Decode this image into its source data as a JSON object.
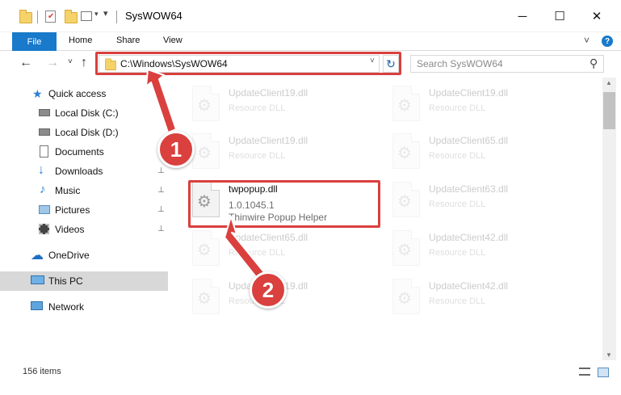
{
  "window": {
    "title": "SysWOW64",
    "minimize": "─",
    "maximize": "☐",
    "close": "✕"
  },
  "ribbon": {
    "tabs": [
      "File",
      "Home",
      "Share",
      "View"
    ],
    "expand": "˅",
    "help": "?"
  },
  "navigation": {
    "back": "←",
    "forward": "→",
    "recent": "˅",
    "up": "↑",
    "address": "C:\\Windows\\SysWOW64",
    "address_dropdown": "˅",
    "refresh": "↻",
    "search_placeholder": "Search SysWOW64",
    "search_icon": "⚲"
  },
  "sidebar": {
    "items": [
      {
        "label": "Quick access",
        "icon": "star-icon"
      },
      {
        "label": "Local Disk (C:)",
        "icon": "drive-icon",
        "pinned": true
      },
      {
        "label": "Local Disk (D:)",
        "icon": "drive-icon",
        "pinned": true
      },
      {
        "label": "Documents",
        "icon": "documents-icon",
        "pinned": true
      },
      {
        "label": "Downloads",
        "icon": "download-icon",
        "pinned": true
      },
      {
        "label": "Music",
        "icon": "music-icon",
        "pinned": true
      },
      {
        "label": "Pictures",
        "icon": "pictures-icon",
        "pinned": true
      },
      {
        "label": "Videos",
        "icon": "videos-icon",
        "pinned": true
      },
      {
        "label": "OneDrive",
        "icon": "cloud-icon"
      },
      {
        "label": "This PC",
        "icon": "computer-icon",
        "selected": true
      },
      {
        "label": "Network",
        "icon": "network-icon"
      }
    ],
    "pin_glyph": "📌"
  },
  "files": {
    "left": [
      {
        "name": "UpdateClient19.dll",
        "desc": "Resource DLL",
        "faded": true
      },
      {
        "name": "UpdateClient19.dll",
        "desc": "Resource DLL",
        "faded": true
      },
      {
        "name": "twpopup.dll",
        "desc": "1.0.1045.1",
        "desc2": "Thinwire Popup Helper",
        "faded": false
      },
      {
        "name": "UpdateClient65.dll",
        "desc": "Resource DLL",
        "faded": true
      },
      {
        "name": "UpdateClient19.dll",
        "desc": "Resource DLL",
        "faded": true
      }
    ],
    "right": [
      {
        "name": "UpdateClient19.dll",
        "desc": "Resource DLL"
      },
      {
        "name": "UpdateClient65.dll",
        "desc": "Resource DLL"
      },
      {
        "name": "UpdateClient63.dll",
        "desc": "Resource DLL"
      },
      {
        "name": "UpdateClient42.dll",
        "desc": "Resource DLL"
      },
      {
        "name": "UpdateClient42.dll",
        "desc": "Resource DLL"
      }
    ]
  },
  "status": {
    "items_count": "156 items"
  },
  "annotations": {
    "step1": "1",
    "step2": "2",
    "highlight_color": "#d9403e"
  },
  "colors": {
    "accent": "#1979ca",
    "selected_bg": "#d8d8d8"
  }
}
